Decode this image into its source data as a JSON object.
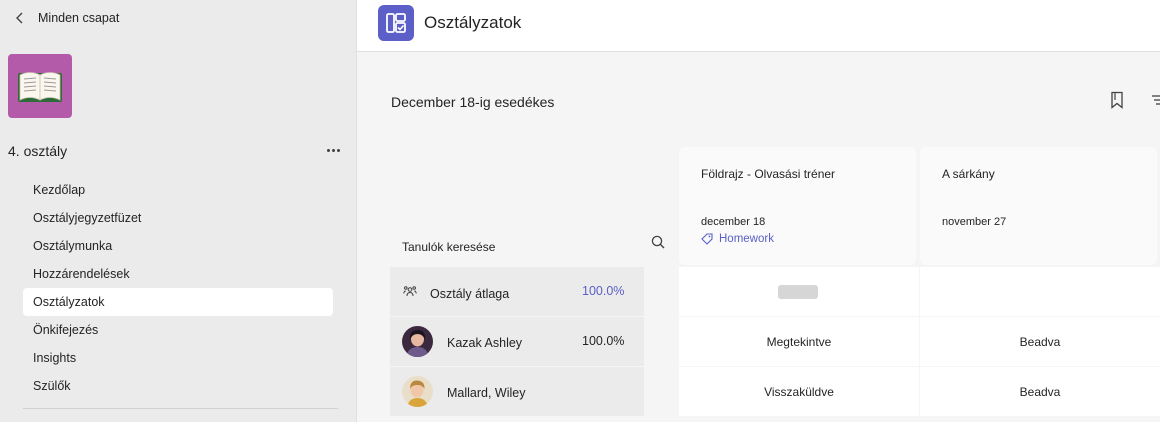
{
  "sidebar": {
    "back_label": "Minden csapat",
    "team_name": "4. osztály",
    "items": [
      {
        "label": "Kezdőlap",
        "active": false
      },
      {
        "label": "Osztályjegyzetfüzet",
        "active": false
      },
      {
        "label": "Osztálymunka",
        "active": false
      },
      {
        "label": "Hozzárendelések",
        "active": false
      },
      {
        "label": "Osztályzatok",
        "active": true
      },
      {
        "label": "Önkifejezés",
        "active": false
      },
      {
        "label": "Insights",
        "active": false
      },
      {
        "label": "Szülők",
        "active": false
      }
    ]
  },
  "header": {
    "title": "Osztályzatok"
  },
  "main": {
    "due_label": "December 18-ig esedékes",
    "search_label": "Tanulók keresése",
    "assignments": [
      {
        "title": "Földrajz - Olvasási tréner",
        "date": "december 18",
        "tag": "Homework"
      },
      {
        "title": "A sárkány",
        "date": "november 27"
      }
    ],
    "class_average": {
      "label": "Osztály átlaga",
      "percent": "100.0%"
    },
    "students": [
      {
        "name": "Kazak Ashley",
        "percent": "100.0%",
        "statuses": [
          "Megtekintve",
          "Beadva"
        ]
      },
      {
        "name": "Mallard, Wiley",
        "percent": "",
        "statuses": [
          "Visszaküldve",
          "Beadva"
        ]
      }
    ]
  },
  "colors": {
    "accent": "#5b5fc7",
    "team_avatar": "#b35aa9"
  }
}
